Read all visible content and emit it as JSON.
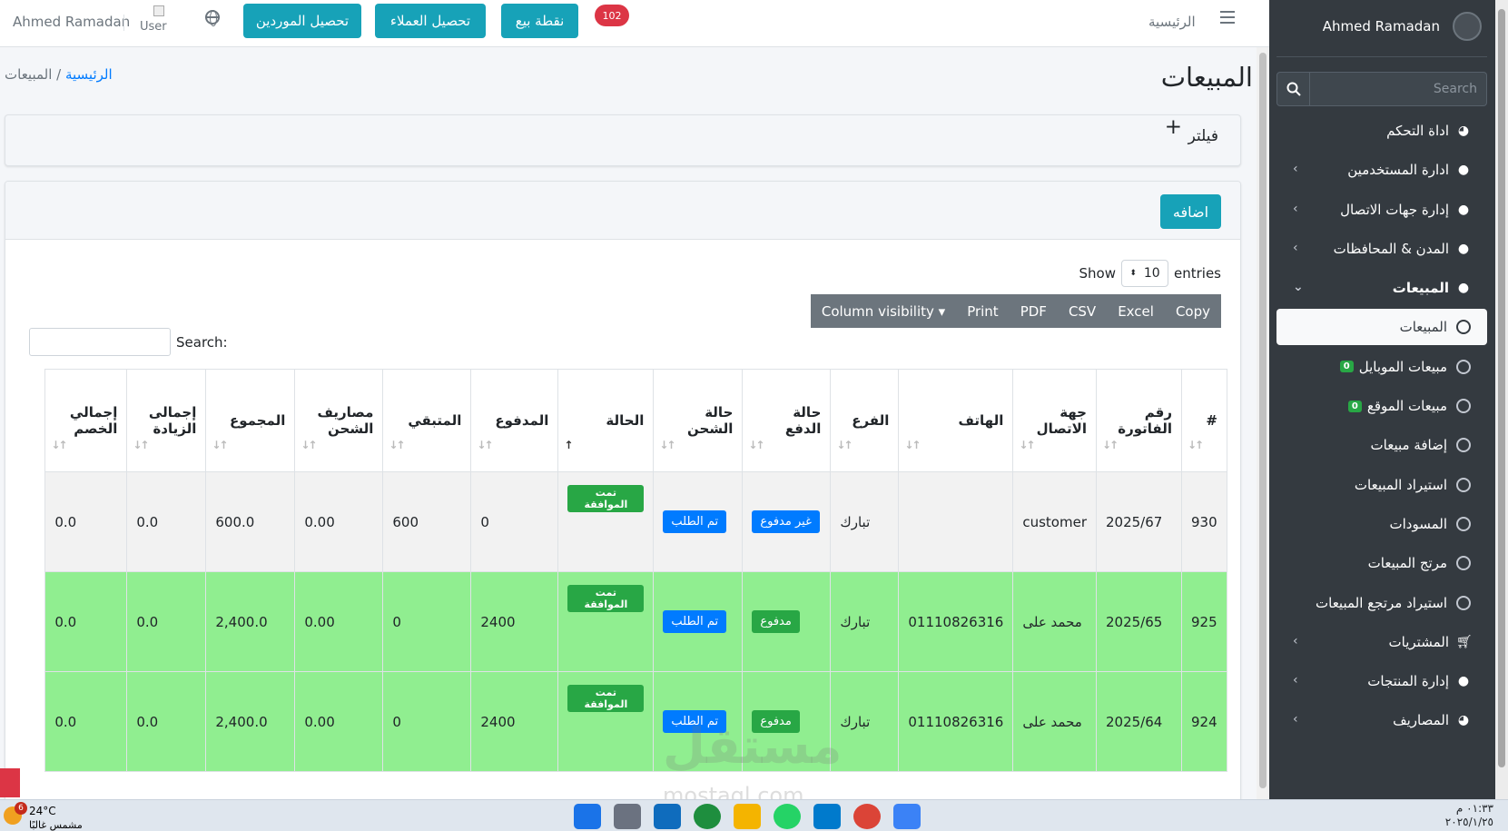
{
  "topbar": {
    "user_name": "Ahmed Ramadan",
    "user_img_alt": "User",
    "btn_suppliers": "تحصيل الموردين",
    "btn_customers": "تحصيل العملاء",
    "btn_pos": "نقطة بيع",
    "notif_count": "102",
    "home_link": "الرئيسية"
  },
  "breadcrumb": {
    "home": "الرئيسية",
    "sep": " / ",
    "current": "المبيعات"
  },
  "page_title": "المبيعات",
  "filter": {
    "title": "فيلتر",
    "plus": "+"
  },
  "card": {
    "add_label": "اضافه"
  },
  "datatable": {
    "show_label": "Show",
    "entries_value": "10",
    "entries_label": "entries",
    "buttons": [
      "Copy",
      "Excel",
      "CSV",
      "PDF",
      "Print",
      "Column visibility ▾"
    ],
    "search_label": "Search:"
  },
  "table": {
    "headers": [
      "#",
      "رقم الفاتورة",
      "جهة الاتصال",
      "الهاتف",
      "الفرع",
      "حالة الدفع",
      "حالة الشحن",
      "الحالة",
      "المدفوع",
      "المتبقي",
      "مصاريف الشحن",
      "المجموع",
      "إجمالى الزيادة",
      "إجمالي الخصم"
    ],
    "rows": [
      {
        "id": "930",
        "invoice": "2025/67",
        "contact": "customer",
        "phone": "",
        "branch": "تبارك",
        "pay_status": "غير مدفوع",
        "ship_status": "تم الطلب",
        "status": "تمت الموافقة",
        "paid": "0",
        "remaining": "600",
        "shipping": "0.00",
        "total": "600.0",
        "increase": "0.0",
        "discount": "0.0"
      },
      {
        "id": "925",
        "invoice": "2025/65",
        "contact": "محمد على",
        "phone": "01110826316",
        "branch": "تبارك",
        "pay_status": "مدفوع",
        "ship_status": "تم الطلب",
        "status": "تمت الموافقة",
        "paid": "2400",
        "remaining": "0",
        "shipping": "0.00",
        "total": "2,400.0",
        "increase": "0.0",
        "discount": "0.0"
      },
      {
        "id": "924",
        "invoice": "2025/64",
        "contact": "محمد على",
        "phone": "01110826316",
        "branch": "تبارك",
        "pay_status": "مدفوع",
        "ship_status": "تم الطلب",
        "status": "تمت الموافقة",
        "paid": "2400",
        "remaining": "0",
        "shipping": "0.00",
        "total": "2,400.0",
        "increase": "0.0",
        "discount": "0.0"
      }
    ]
  },
  "sidebar": {
    "user_name": "Ahmed Ramadan",
    "search_placeholder": "Search",
    "items": [
      {
        "label": "اداة التحكم",
        "icon": "dashboard-icon"
      },
      {
        "label": "ادارة المستخدمين",
        "icon": "user-icon"
      },
      {
        "label": "إدارة جهات الاتصال",
        "icon": "user-icon"
      },
      {
        "label": "المدن & المحافظات",
        "icon": "user-icon"
      },
      {
        "label": "المبيعات",
        "icon": "user-icon"
      },
      {
        "label": "المبيعات",
        "icon": "circle-icon"
      },
      {
        "label": "مبيعات الموبايل",
        "badge": "0",
        "icon": "circle-icon"
      },
      {
        "label": "مبيعات الموقع",
        "badge": "0",
        "icon": "circle-icon"
      },
      {
        "label": "إضافة مبيعات",
        "icon": "circle-icon"
      },
      {
        "label": "استيراد المبيعات",
        "icon": "circle-icon"
      },
      {
        "label": "المسودات",
        "icon": "circle-icon"
      },
      {
        "label": "مرتج المبيعات",
        "icon": "circle-icon"
      },
      {
        "label": "استيراد مرتجع المبيعات",
        "icon": "circle-icon"
      },
      {
        "label": "المشتريات",
        "icon": "cart-icon"
      },
      {
        "label": "إدارة المنتجات",
        "icon": "user-icon"
      },
      {
        "label": "المصاريف",
        "icon": "dashboard-icon"
      }
    ]
  },
  "taskbar": {
    "weather_temp": "24°C",
    "weather_desc": "مشمس غالبًا",
    "weather_badge": "6",
    "time": "٠١:٣٣ م",
    "date": "٢٠٢٥/١/٢٥"
  },
  "watermark": {
    "text": "مستقل",
    "sub": "mostaql.com"
  },
  "colors": {
    "primary": "#17a2b8",
    "sidebar": "#343a40",
    "row_green": "#90ee90",
    "badge_red": "#dc3545",
    "link": "#007bff"
  }
}
